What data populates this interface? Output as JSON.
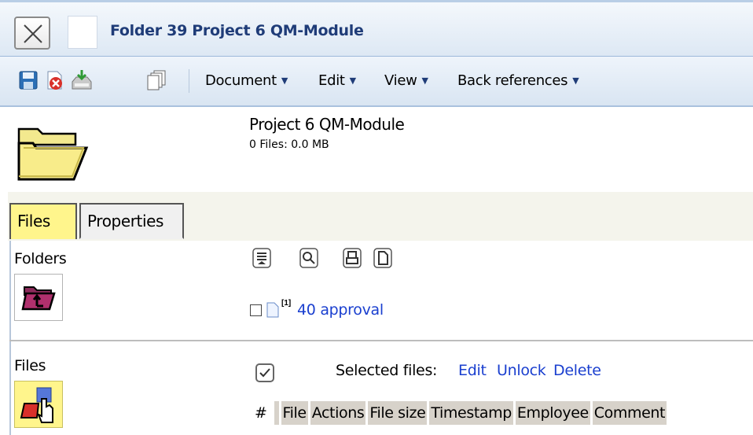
{
  "window": {
    "title": "Folder 39 Project 6 QM-Module"
  },
  "toolbar": {
    "icons": [
      "save-icon",
      "delete-icon",
      "download-icon",
      "copy-icon"
    ],
    "menus": [
      {
        "label": "Document"
      },
      {
        "label": "Edit"
      },
      {
        "label": "View"
      },
      {
        "label": "Back references"
      }
    ]
  },
  "header": {
    "name": "Project 6 QM-Module",
    "info": "0 Files: 0.0 MB"
  },
  "tabs": [
    {
      "label": "Files",
      "active": true
    },
    {
      "label": "Properties",
      "active": false
    }
  ],
  "folders_section": {
    "label": "Folders",
    "items": [
      {
        "marker": "[1]",
        "name": "40 approval"
      }
    ]
  },
  "files_section": {
    "label": "Files",
    "selected_label": "Selected files:",
    "actions": [
      "Edit",
      "Unlock",
      "Delete"
    ],
    "columns": [
      "#",
      "File",
      "Actions",
      "File size",
      "Timestamp",
      "Employee",
      "Comment"
    ]
  },
  "colors": {
    "title_text": "#1f3c78",
    "link": "#1a3fcf",
    "active_tab": "#fff58c",
    "column_header_bg": "#d7d2ca"
  }
}
